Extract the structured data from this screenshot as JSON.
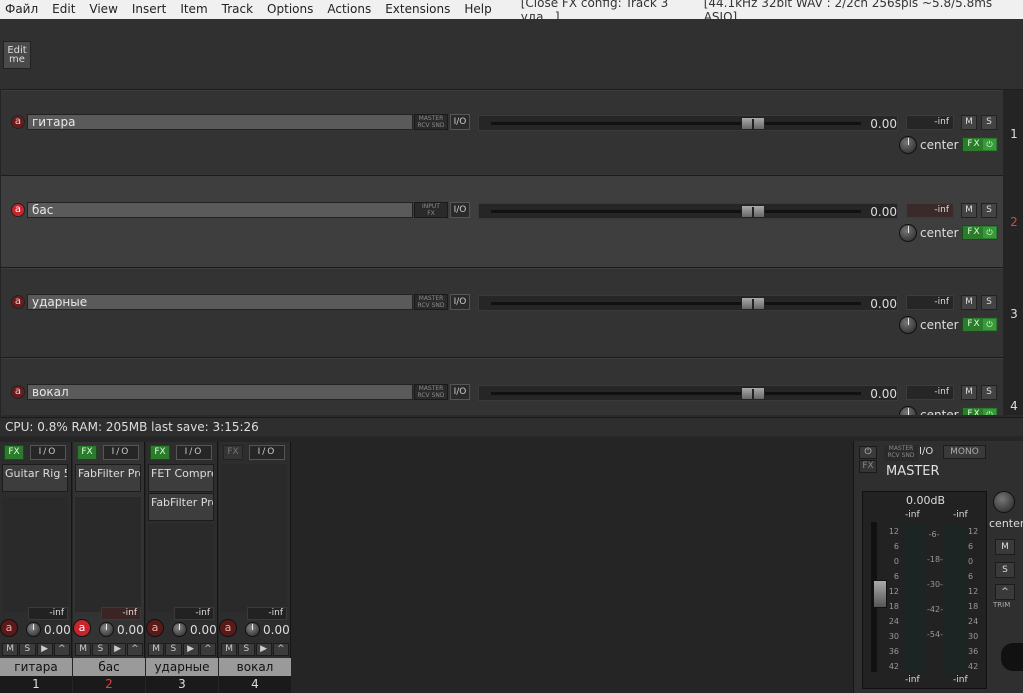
{
  "menu": {
    "items": [
      "Файл",
      "Edit",
      "View",
      "Insert",
      "Item",
      "Track",
      "Options",
      "Actions",
      "Extensions",
      "Help"
    ],
    "title": "[Close FX config: Track 3 уда...]",
    "status": "[44.1kHz 32bit WAV : 2/2ch 256spls ~5.8/5.8ms ASIO]"
  },
  "toolbar": {
    "editme": "Edit me"
  },
  "tracks": [
    {
      "name": "гитара",
      "route": "MASTER\nRCV SND",
      "io": "I/O",
      "vol": "0.00",
      "meter": "-inf",
      "pan": "center",
      "num": "1",
      "mute": "M",
      "solo": "S",
      "fx": "FX"
    },
    {
      "name": "бас",
      "route": "INPUT\nFX",
      "io": "I/O",
      "vol": "0.00",
      "meter": "-inf",
      "pan": "center",
      "num": "2",
      "mute": "M",
      "solo": "S",
      "fx": "FX"
    },
    {
      "name": "ударные",
      "route": "MASTER\nRCV SND",
      "io": "I/O",
      "vol": "0.00",
      "meter": "-inf",
      "pan": "center",
      "num": "3",
      "mute": "M",
      "solo": "S",
      "fx": "FX"
    },
    {
      "name": "вокал",
      "route": "MASTER\nRCV SND",
      "io": "I/O",
      "vol": "0.00",
      "meter": "-inf",
      "pan": "center",
      "num": "4",
      "mute": "M",
      "solo": "S",
      "fx": "FX"
    }
  ],
  "statusbar": {
    "text": "CPU: 0.8%  RAM: 205MB  last save: 3:15:26"
  },
  "mixer": {
    "strips": [
      {
        "fx": "FX",
        "io": "I/O",
        "plugins": [
          "Guitar Rig 5"
        ],
        "meter": "-inf",
        "vol": "0.00",
        "name": "гитара",
        "num": "1"
      },
      {
        "fx": "FX",
        "io": "I/O",
        "plugins": [
          "FabFilter Pro"
        ],
        "meter": "-inf",
        "vol": "0.00",
        "name": "бас",
        "num": "2"
      },
      {
        "fx": "FX",
        "io": "I/O",
        "plugins": [
          "FET Compre",
          "FabFilter Pro"
        ],
        "meter": "-inf",
        "vol": "0.00",
        "name": "ударные",
        "num": "3"
      },
      {
        "fx": "FX",
        "io": "I/O",
        "plugins": [],
        "meter": "-inf",
        "vol": "0.00",
        "name": "вокал",
        "num": "4"
      }
    ],
    "strip_buttons": [
      "M",
      "S",
      "▶",
      "^"
    ]
  },
  "master": {
    "title": "MASTER",
    "route": "MASTER\nRCV SND",
    "io": "I/O",
    "mono": "MONO",
    "db": "0.00dB",
    "peak_left": "-inf",
    "peak_right": "-inf",
    "bottom_left": "-inf",
    "bottom_right": "-inf",
    "pan": "center",
    "mute": "M",
    "solo": "S",
    "trim": "TRIM",
    "scale_left": [
      "12",
      "6",
      "0",
      "6",
      "12",
      "18",
      "24",
      "30",
      "36",
      "42"
    ],
    "scale_mid": [
      "-6-",
      "-18-",
      "-30-",
      "-42-",
      "-54-"
    ],
    "scale_right": [
      "12",
      "6",
      "0",
      "6",
      "12",
      "18",
      "24",
      "30",
      "36",
      "42"
    ]
  },
  "colors": {
    "fx_green": "#2c7a2c",
    "record_red": "#c8242c",
    "selected_num": "#e04040"
  }
}
